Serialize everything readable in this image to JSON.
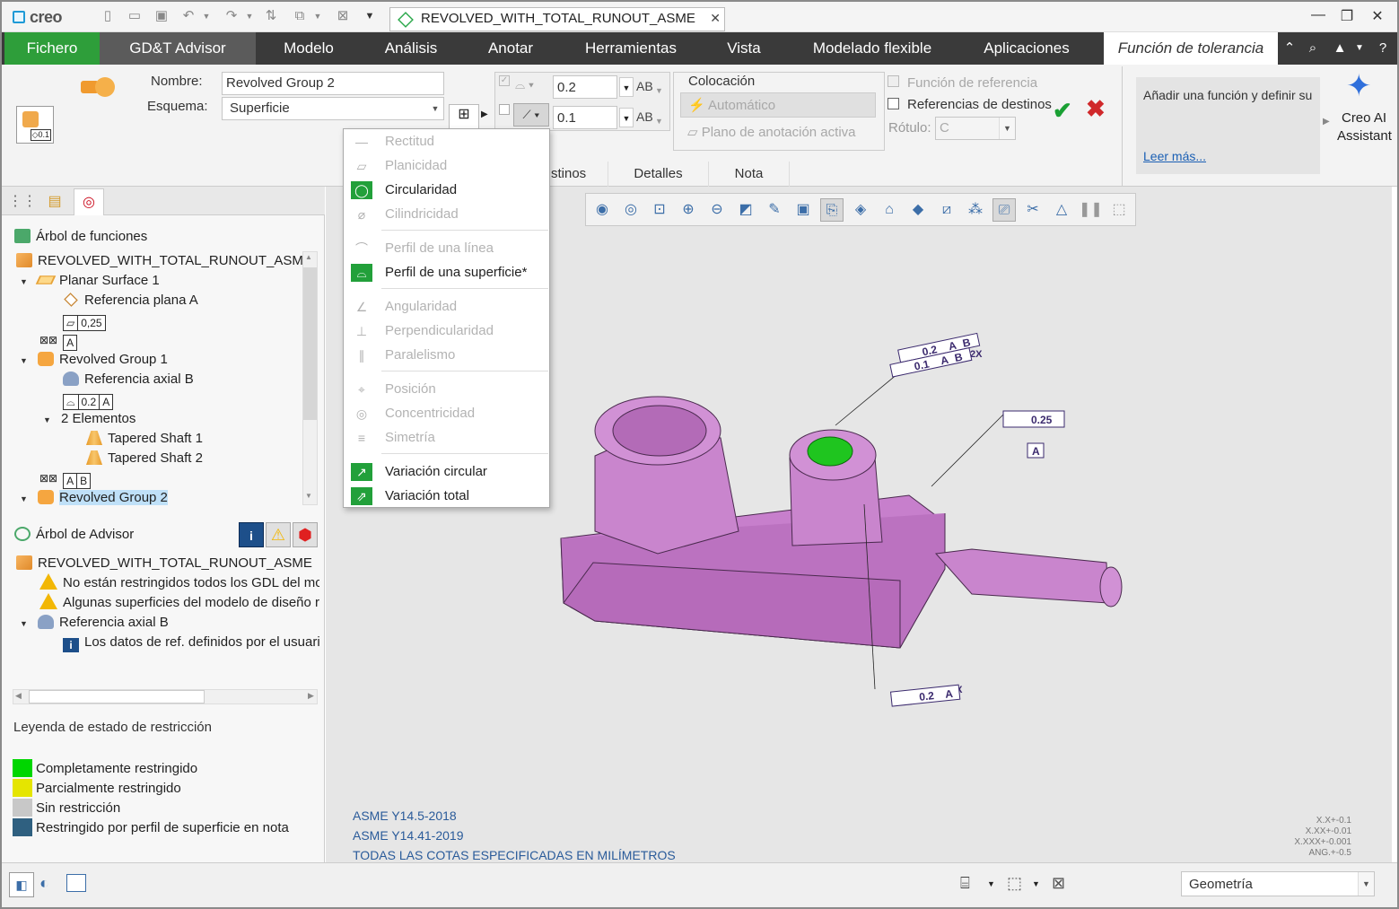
{
  "titlebar": {
    "app": "creo",
    "doc_tab": "REVOLVED_WITH_TOTAL_RUNOUT_ASME"
  },
  "ribbon": {
    "tabs": [
      "Fichero",
      "GD&T Advisor",
      "Modelo",
      "Análisis",
      "Anotar",
      "Herramientas",
      "Vista",
      "Modelado flexible",
      "Aplicaciones"
    ],
    "active_tab": "Función de tolerancia"
  },
  "tool": {
    "nombre_label": "Nombre:",
    "nombre_value": "Revolved Group 2",
    "esquema_label": "Esquema:",
    "esquema_value": "Superficie",
    "tol1": "0.2",
    "tol2": "0.1",
    "ab1": "AB",
    "ab2": "AB",
    "colocacion": "Colocación",
    "automatico": "Automático",
    "plano": "Plano de anotación activa",
    "func_ref": "Función de referencia",
    "ref_dest": "Referencias de destinos",
    "rotulo_label": "Rótulo:",
    "rotulo_value": "C",
    "help_text": "Añadir una función y definir su",
    "help_link": "Leer más...",
    "ai_label_1": "Creo AI",
    "ai_label_2": "Assistant",
    "subtabs": [
      "stinos",
      "Detalles",
      "Nota"
    ]
  },
  "dropdown": {
    "items": [
      {
        "label": "Rectitud",
        "enabled": false,
        "icon": "straightness-icon"
      },
      {
        "label": "Planicidad",
        "enabled": false,
        "icon": "flatness-icon"
      },
      {
        "label": "Circularidad",
        "enabled": true,
        "icon": "circularity-icon"
      },
      {
        "label": "Cilindricidad",
        "enabled": false,
        "icon": "cylindricity-icon"
      },
      {
        "label": "Perfil de una línea",
        "enabled": false,
        "icon": "line-profile-icon"
      },
      {
        "label": "Perfil de una superficie*",
        "enabled": true,
        "icon": "surface-profile-icon"
      },
      {
        "label": "Angularidad",
        "enabled": false,
        "icon": "angularity-icon"
      },
      {
        "label": "Perpendicularidad",
        "enabled": false,
        "icon": "perpendicularity-icon"
      },
      {
        "label": "Paralelismo",
        "enabled": false,
        "icon": "parallelism-icon"
      },
      {
        "label": "Posición",
        "enabled": false,
        "icon": "position-icon"
      },
      {
        "label": "Concentricidad",
        "enabled": false,
        "icon": "concentricity-icon"
      },
      {
        "label": "Simetría",
        "enabled": false,
        "icon": "symmetry-icon"
      },
      {
        "label": "Variación circular",
        "enabled": true,
        "icon": "circular-runout-icon"
      },
      {
        "label": "Variación total",
        "enabled": true,
        "icon": "total-runout-icon"
      }
    ]
  },
  "tree": {
    "header": "Árbol de funciones",
    "nodes": {
      "root": "REVOLVED_WITH_TOTAL_RUNOUT_ASME",
      "planar": "Planar Surface 1",
      "refA": "Referencia plana A",
      "flat_val": "0,25",
      "datumA": "A",
      "rg1": "Revolved Group 1",
      "refB": "Referencia axial B",
      "prof_val": "0.2",
      "prof_ref": "A",
      "elems": "2 Elementos",
      "ts1": "Tapered Shaft 1",
      "ts2": "Tapered Shaft 2",
      "datumA2": "A",
      "datumB2": "B",
      "rg2": "Revolved Group 2"
    }
  },
  "advisor": {
    "header": "Árbol de Advisor",
    "root": "REVOLVED_WITH_TOTAL_RUNOUT_ASME",
    "w1": "No están restringidos todos los GDL del mc",
    "w2": "Algunas superficies del modelo de diseño r",
    "refB": "Referencia axial B",
    "info": "Los datos de ref. definidos por el usuari"
  },
  "legend": {
    "title": "Leyenda de estado de restricción",
    "items": [
      {
        "label": "Completamente restringido",
        "color": "#00d600"
      },
      {
        "label": "Parcialmente restringido",
        "color": "#e5e500"
      },
      {
        "label": "Sin restricción",
        "color": "#c8c8c8"
      },
      {
        "label": "Restringido por perfil de superficie en nota",
        "color": "#2f6080"
      }
    ]
  },
  "viewport": {
    "notes": [
      "ASME Y14.5-2018",
      "ASME Y14.41-2019",
      "TODAS LAS COTAS ESPECIFICADAS EN MILÍMETROS"
    ],
    "tol_table": [
      "X.X+-0.1",
      "X.XX+-0.01",
      "X.XXX+-0.001",
      "ANG.+-0.5"
    ],
    "fcf_top": {
      "count": "2X",
      "row1": [
        "0.2",
        "A",
        "B"
      ],
      "row2": [
        "0.1",
        "A",
        "B"
      ]
    },
    "fcf_flat": {
      "val": "0.25",
      "datum": "A"
    },
    "fcf_bottom": {
      "count": "2X",
      "row": [
        "0.2",
        "A"
      ]
    },
    "colors": {
      "part": "#c77fcc",
      "green_face": "#1fc51f"
    }
  },
  "status": {
    "filter": "Geometría"
  }
}
